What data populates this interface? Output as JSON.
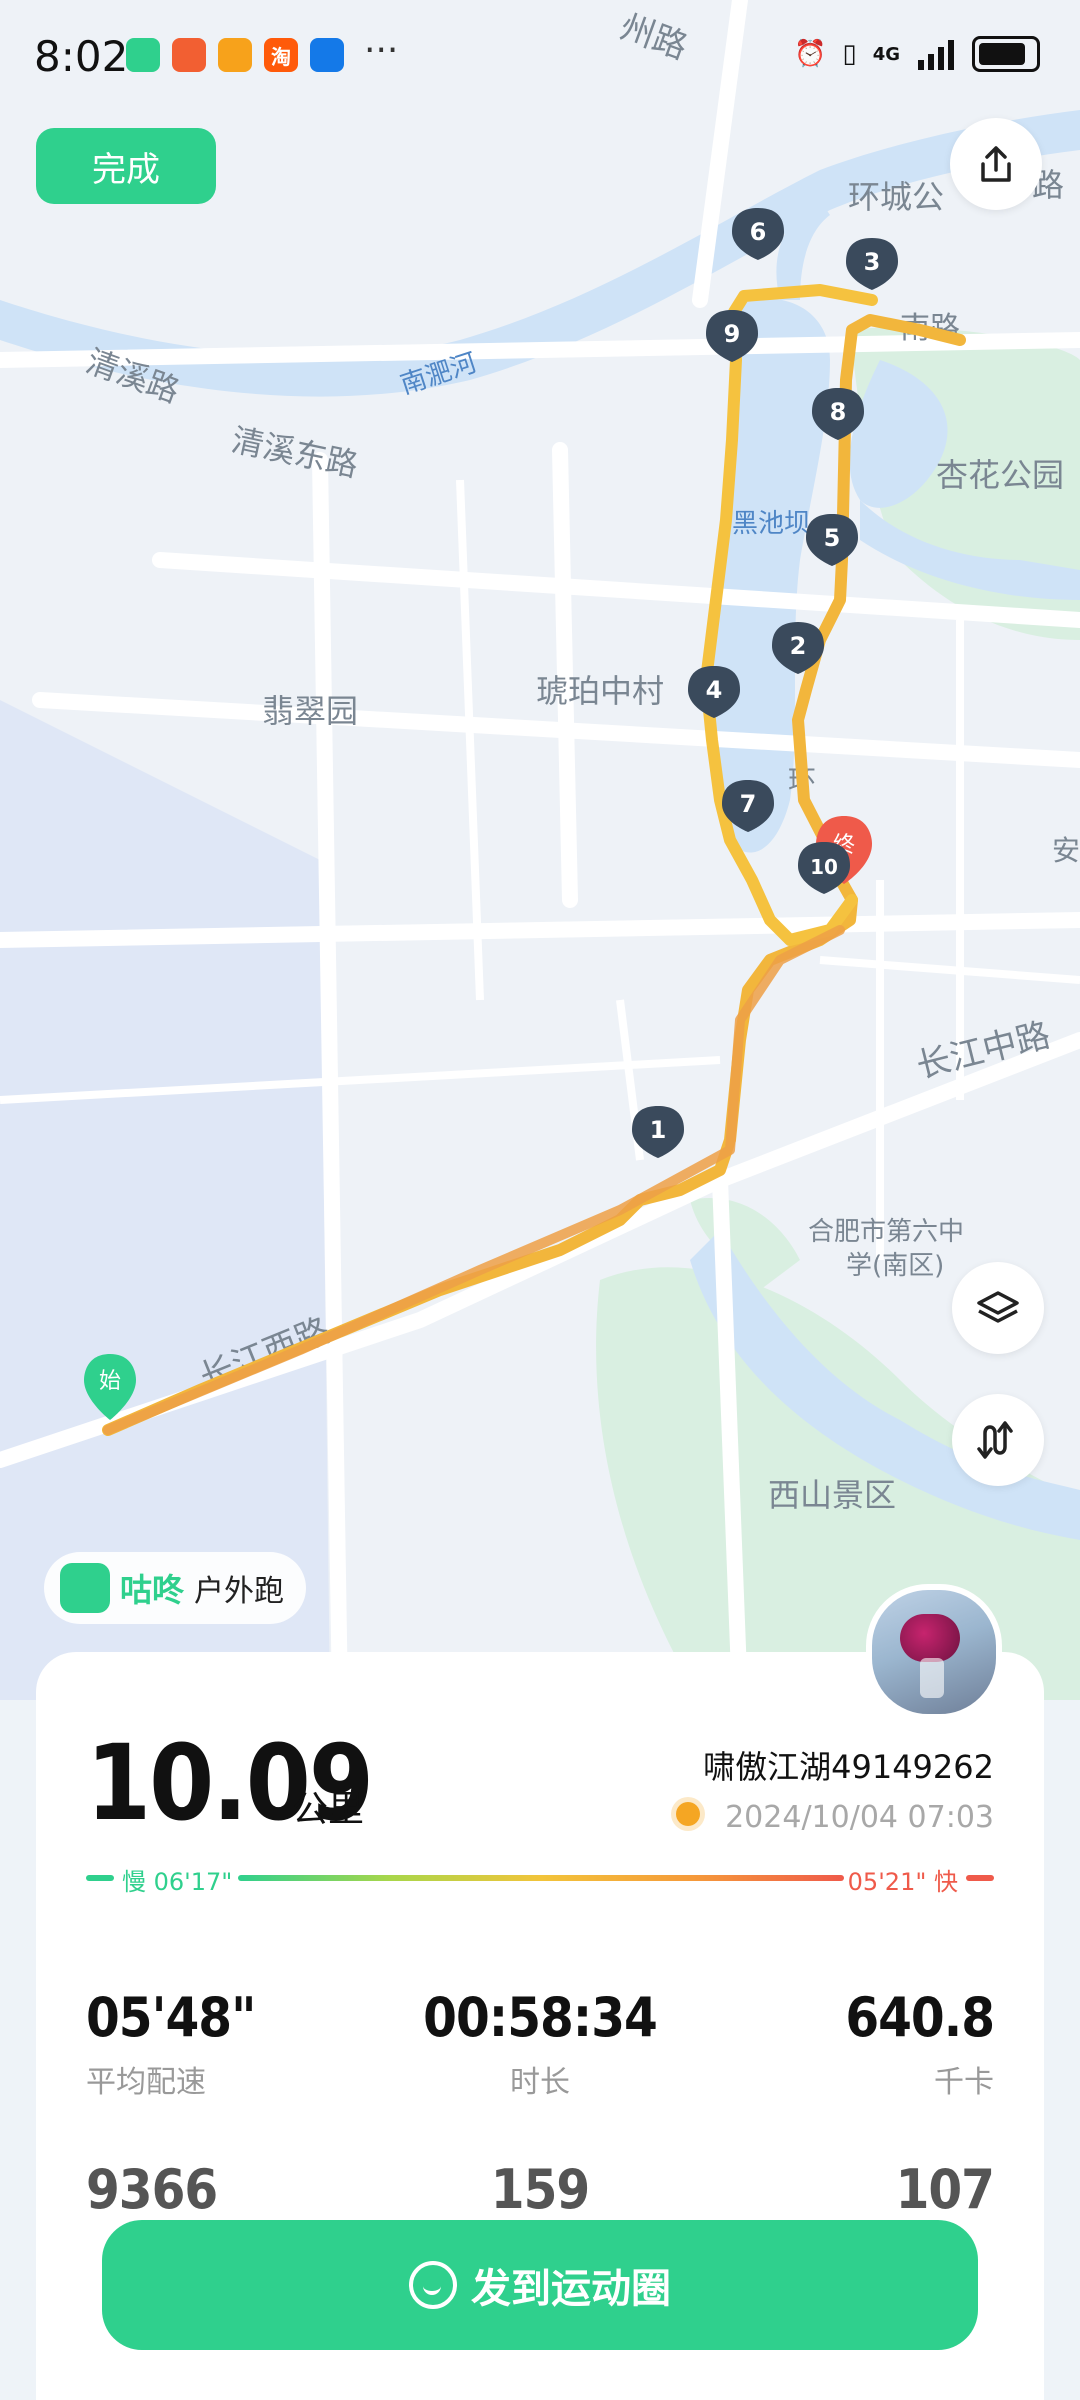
{
  "status_bar": {
    "time": "8:02",
    "network": "4G",
    "app_icons": [
      {
        "name": "app-green-icon",
        "glyph": "",
        "color": "#2fd08d"
      },
      {
        "name": "weibo-icon",
        "glyph": "",
        "color": "#f25f32"
      },
      {
        "name": "app-orange-icon",
        "glyph": "",
        "color": "#f7a21b"
      },
      {
        "name": "taobao-icon",
        "glyph": "淘",
        "color": "#ff5a0a"
      },
      {
        "name": "app-blue-icon",
        "glyph": "",
        "color": "#1479e8"
      }
    ]
  },
  "toolbar": {
    "done_label": "完成"
  },
  "map": {
    "labels": {
      "road_top": "州路",
      "huancheng": "环城公",
      "huancheng_road": "路",
      "qingxi": "清溪路",
      "qingxi_east": "清溪东路",
      "river": "南淝河",
      "heichiba": "黑池坝",
      "xinghua": "杏花公园",
      "hupo": "琥珀中村",
      "feicui": "翡翠园",
      "changjiang_mid": "长江中路",
      "changjiang_west": "长江西路",
      "school": "合肥市第六中学(南区)",
      "xishan": "西山景区",
      "an": "安",
      "nan": "南路",
      "huan": "环"
    },
    "start_label": "始",
    "end_label": "终",
    "km_markers": [
      "1",
      "2",
      "3",
      "4",
      "5",
      "6",
      "7",
      "8",
      "9",
      "10"
    ]
  },
  "brand": {
    "name": "咕咚",
    "sub": "户外跑"
  },
  "summary": {
    "distance": "10.09",
    "unit": "公里",
    "username": "啸傲江湖49149262",
    "datetime": "2024/10/04 07:03"
  },
  "pace_legend": {
    "slow": "慢 06'17\"",
    "fast": "05'21\" 快"
  },
  "stats": [
    {
      "value": "05'48\"",
      "label": "平均配速"
    },
    {
      "value": "00:58:34",
      "label": "时长"
    },
    {
      "value": "640.8",
      "label": "千卡"
    },
    {
      "value": "9366",
      "label": ""
    },
    {
      "value": "159",
      "label": ""
    },
    {
      "value": "107",
      "label": ""
    }
  ],
  "share": {
    "label": "发到运动圈"
  },
  "colors": {
    "accent": "#2fd08d",
    "route": "#f2b63c",
    "route_dark": "#eda046",
    "marker": "#3a4a5c",
    "end_marker": "#ef5a4a",
    "water": "#cfe3f7",
    "park": "#d9efe1"
  }
}
